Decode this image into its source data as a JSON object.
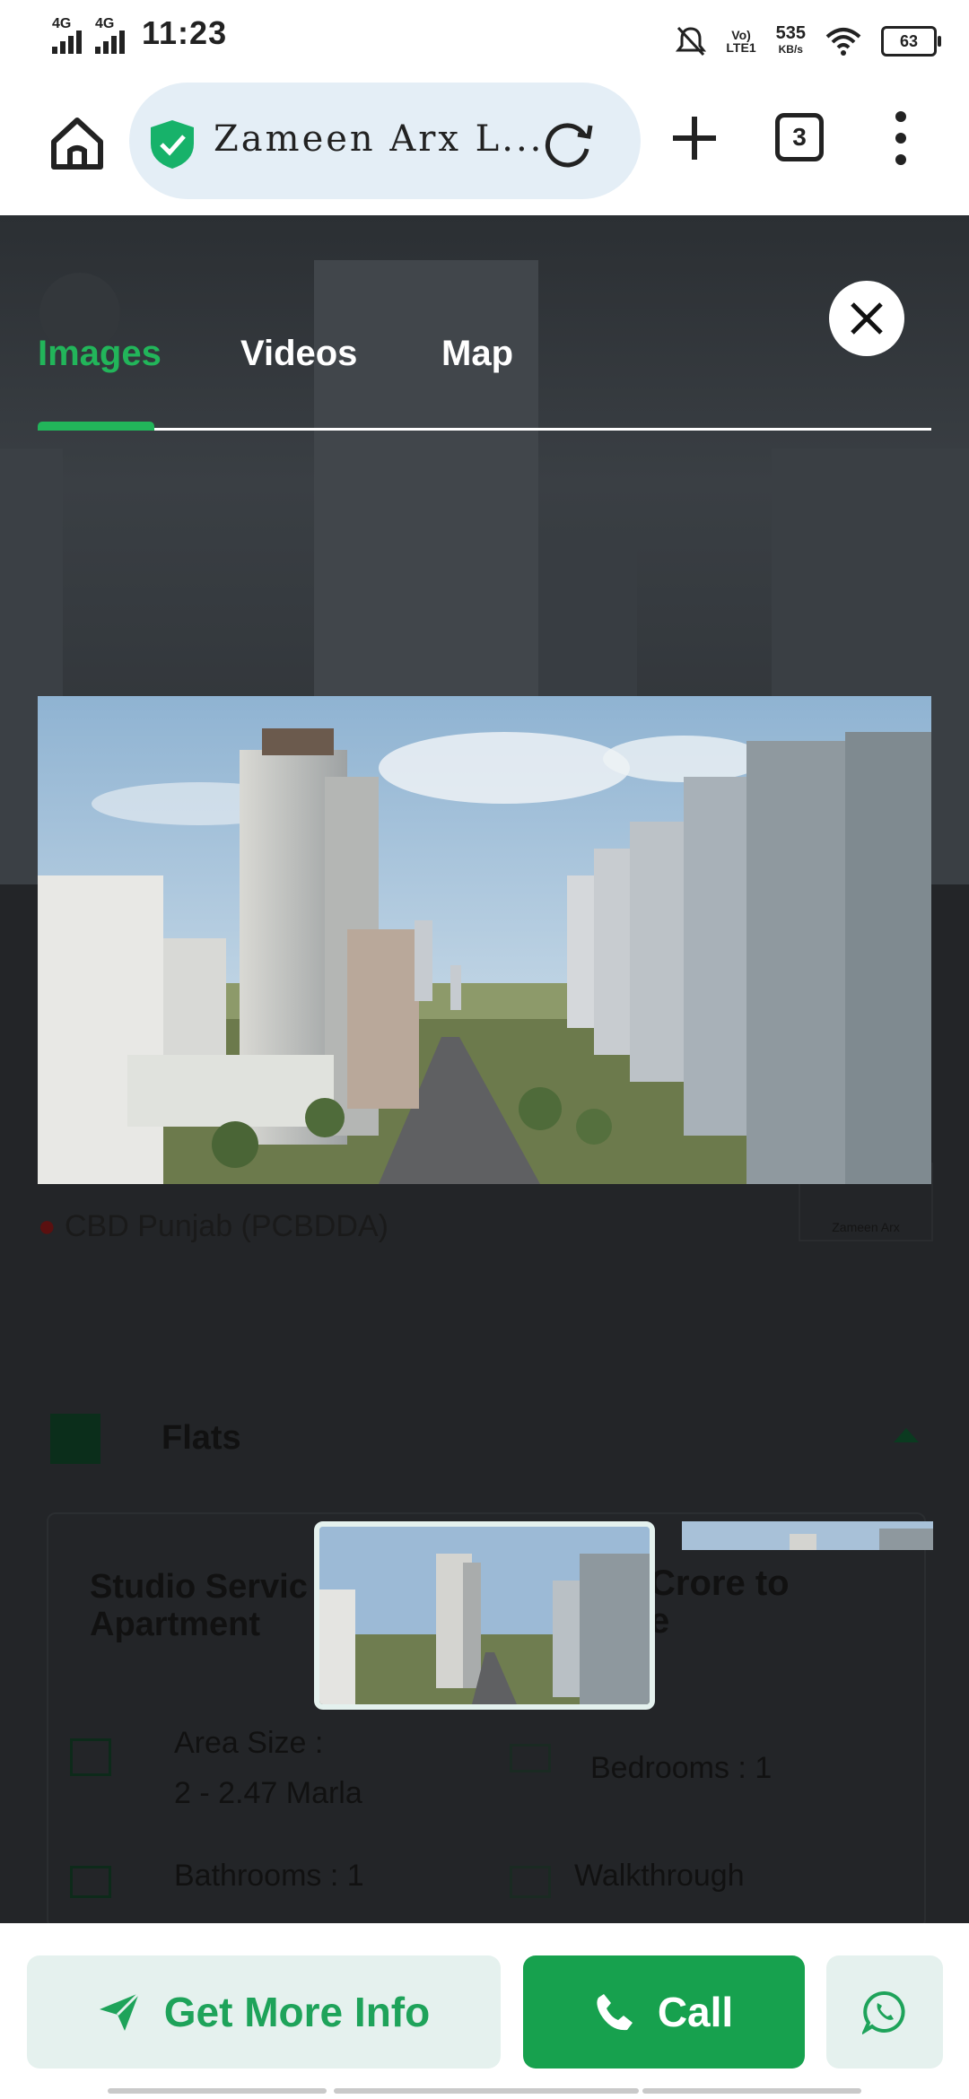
{
  "status_bar": {
    "sim1": "4G",
    "sim2": "4G",
    "time": "11:23",
    "volte_line1": "Vo)",
    "volte_line2": "LTE1",
    "speed_value": "535",
    "speed_unit": "KB/s",
    "battery": "63"
  },
  "browser": {
    "url_title": "Zameen Arx L...",
    "tab_count": "3"
  },
  "gallery": {
    "tabs": [
      "Images",
      "Videos",
      "Map"
    ],
    "active_tab": "Images"
  },
  "background_page": {
    "project_title": "Zameen Arx",
    "location": "CBD Punjab (PCBDDA)",
    "logo_text": "Zameen Arx",
    "section": "Flats",
    "unit_title_line1": "Studio Servic",
    "unit_title_line2": "Apartment",
    "price_line1": "Crore to",
    "price_line2": "e",
    "area_label": "Area Size :",
    "area_value": "2 - 2.47 Marla",
    "bedrooms_label": "Bedrooms :",
    "bedrooms_value": "1",
    "bathrooms_label": "Bathrooms :",
    "bathrooms_value": "1",
    "walkthrough_label": "Walkthrough"
  },
  "actions": {
    "get_more_info": "Get More Info",
    "call": "Call"
  },
  "colors": {
    "accent_green": "#22b55a",
    "call_green": "#17a14e",
    "light_green_bg": "#e5f1ee",
    "url_pill_bg": "#e4eef6"
  },
  "icons": [
    "home-icon",
    "shield-check-icon",
    "reload-icon",
    "plus-icon",
    "tab-switcher-icon",
    "more-vert-icon",
    "close-icon",
    "send-icon",
    "phone-icon",
    "whatsapp-icon"
  ]
}
